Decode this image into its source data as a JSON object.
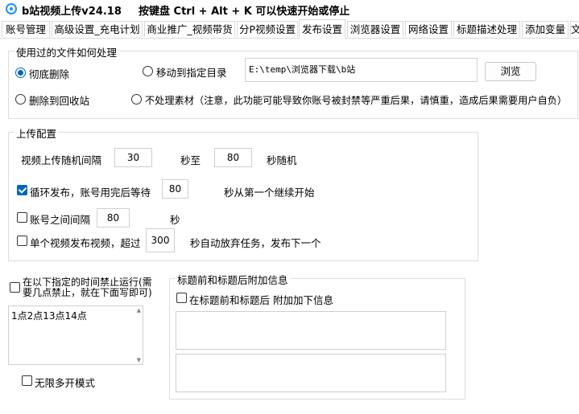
{
  "window": {
    "title": "b站视频上传v24.18",
    "hotkey_hint": "按键盘 Ctrl + Alt + K  可以快速开始或停止"
  },
  "tabs": [
    {
      "label": "账号管理"
    },
    {
      "label": "高级设置_充电计划"
    },
    {
      "label": "商业推广_视频带货"
    },
    {
      "label": "分P视频设置"
    },
    {
      "label": "发布设置",
      "active": true
    },
    {
      "label": "浏览器设置"
    },
    {
      "label": "网络设置"
    },
    {
      "label": "标题描述处理"
    },
    {
      "label": "添加变量"
    },
    {
      "label": "文"
    }
  ],
  "file_handling": {
    "legend": "使用过的文件如何处理",
    "options": [
      {
        "label": "彻底删除",
        "selected": true
      },
      {
        "label": "移动到指定目录",
        "selected": false
      },
      {
        "label": "删除到回收站",
        "selected": false
      },
      {
        "label": "不处理素材（注意，此功能可能导致你账号被封禁等严重后果，请慎重，造成后果需要用户自负）",
        "selected": false
      }
    ],
    "move_path": "E:\\temp\\浏览器下载\\b站",
    "browse_button": "浏览"
  },
  "upload_config": {
    "legend": "上传配置",
    "random_interval_label": "视频上传随机间隔",
    "random_min": "30",
    "seconds_to_label": "秒至",
    "random_max": "80",
    "seconds_random_label": "秒随机",
    "loop_publish": {
      "label": "循环发布，账号用完后等待",
      "checked": true,
      "value": "80",
      "suffix": "秒从第一个继续开始"
    },
    "account_interval": {
      "label": "账号之间间隔",
      "checked": false,
      "value": "80",
      "suffix": "秒"
    },
    "single_video_timeout": {
      "label": "单个视频发布视频，超过",
      "checked": false,
      "value": "300",
      "suffix": "秒自动放弃任务，发布下一个"
    }
  },
  "schedule": {
    "label": "在以下指定的时间禁止运行(需要几点禁止，就在下面写即可)",
    "checked": false,
    "hours_text": "1点2点13点14点",
    "unlimited_label": "无限多开模式",
    "unlimited_checked": false
  },
  "title_extra": {
    "legend": "标题前和标题后附加信息",
    "enable_label": "在标题前和标题后 附加加下信息",
    "checked": false,
    "prefix_text": "",
    "suffix_text": ""
  }
}
